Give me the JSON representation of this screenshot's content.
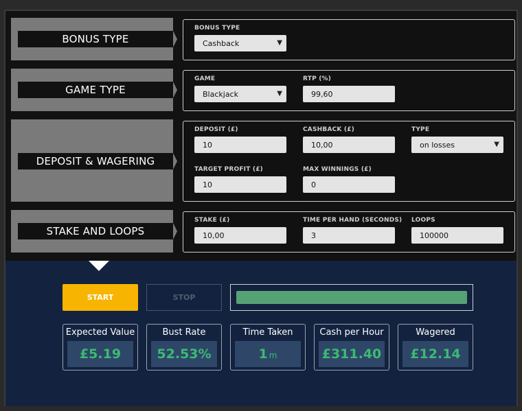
{
  "sections": {
    "bonus": {
      "title": "BONUS TYPE"
    },
    "game": {
      "title": "GAME TYPE"
    },
    "deposit": {
      "title": "DEPOSIT & WAGERING"
    },
    "stake": {
      "title": "STAKE AND LOOPS"
    }
  },
  "fields": {
    "bonus_type": {
      "label": "BONUS TYPE",
      "value": "Cashback"
    },
    "game": {
      "label": "GAME",
      "value": "Blackjack"
    },
    "rtp": {
      "label": "RTP (%)",
      "value": "99,60"
    },
    "deposit": {
      "label": "DEPOSIT (£)",
      "value": "10"
    },
    "cashback": {
      "label": "CASHBACK (£)",
      "value": "10,00"
    },
    "type": {
      "label": "TYPE",
      "value": "on losses"
    },
    "target_profit": {
      "label": "TARGET PROFIT (£)",
      "value": "10"
    },
    "max_winnings": {
      "label": "MAX WINNINGS (£)",
      "value": "0"
    },
    "stake": {
      "label": "STAKE (£)",
      "value": "10,00"
    },
    "time_per_hand": {
      "label": "TIME PER HAND (SECONDS)",
      "value": "3"
    },
    "loops": {
      "label": "LOOPS",
      "value": "100000"
    }
  },
  "controls": {
    "start_label": "START",
    "stop_label": "STOP",
    "progress_fraction": 1.0
  },
  "stats": {
    "expected_value": {
      "title": "Expected Value",
      "value": "£5.19"
    },
    "bust_rate": {
      "title": "Bust Rate",
      "value": "52.53%"
    },
    "time_taken": {
      "title": "Time Taken",
      "value": "1",
      "unit": "m"
    },
    "cash_per_hour": {
      "title": "Cash per Hour",
      "value": "£311.40"
    },
    "wagered": {
      "title": "Wagered",
      "value": "£12.14"
    }
  },
  "icons": {
    "select": "chevron-down-icon"
  },
  "colors": {
    "accent": "#f7b400",
    "value_green": "#3dba73",
    "progress": "#55a374",
    "bottom_bg": "#13223f"
  }
}
